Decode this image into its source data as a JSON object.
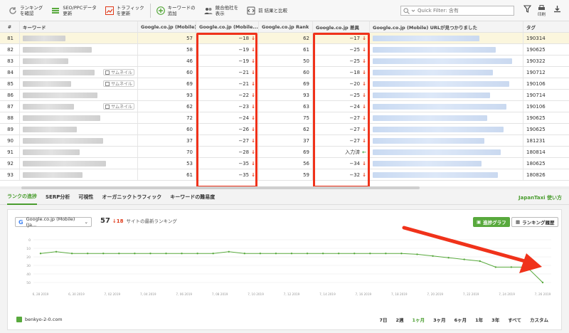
{
  "toolbar": {
    "buttons": [
      {
        "label": "ランキング\nを確認",
        "icon": "refresh-icon"
      },
      {
        "label": "SEO/PPCデータ\n更新",
        "icon": "list-icon"
      },
      {
        "label": "トラフィック\nを更新",
        "icon": "chart-up-icon"
      },
      {
        "label": "キーワードの\n追加",
        "icon": "plus-circle-icon"
      },
      {
        "label": "競合他社を\n表示",
        "icon": "users-icon"
      },
      {
        "label": "前 結果と比較",
        "icon": "compare-icon"
      }
    ],
    "quick_filter_placeholder": "Quick Filter: 含有",
    "right_label": "印刷"
  },
  "columns": [
    "#",
    "キーワード",
    "Google.co.jp (Mobile) ...",
    "Google.co.jp (Mobile...",
    "Google.co.jp Rank",
    "Google.co.jp 差異",
    "Google.co.jp (Mobile) URLが見つかりました",
    "タグ"
  ],
  "thumb_label": "サムネイル",
  "rows": [
    {
      "n": "81",
      "m": "57",
      "md": "−18",
      "r": "62",
      "rd": "−17",
      "tag": "190314",
      "thumb": false,
      "rd_dir": "down",
      "sel": true
    },
    {
      "n": "82",
      "m": "58",
      "md": "−19",
      "r": "61",
      "rd": "−25",
      "tag": "190625",
      "thumb": false,
      "rd_dir": "down"
    },
    {
      "n": "83",
      "m": "46",
      "md": "−19",
      "r": "50",
      "rd": "−25",
      "tag": "190322",
      "thumb": false,
      "rd_dir": "down"
    },
    {
      "n": "84",
      "m": "60",
      "md": "−21",
      "r": "60",
      "rd": "−18",
      "tag": "190712",
      "thumb": true,
      "rd_dir": "down"
    },
    {
      "n": "85",
      "m": "69",
      "md": "−21",
      "r": "69",
      "rd": "−20",
      "tag": "190106",
      "thumb": true,
      "rd_dir": "down"
    },
    {
      "n": "86",
      "m": "93",
      "md": "−22",
      "r": "93",
      "rd": "−25",
      "tag": "190714",
      "thumb": false,
      "rd_dir": "down"
    },
    {
      "n": "87",
      "m": "62",
      "md": "−23",
      "r": "63",
      "rd": "−24",
      "tag": "190106",
      "thumb": true,
      "rd_dir": "down"
    },
    {
      "n": "88",
      "m": "72",
      "md": "−24",
      "r": "75",
      "rd": "−27",
      "tag": "190625",
      "thumb": false,
      "rd_dir": "down"
    },
    {
      "n": "89",
      "m": "60",
      "md": "−26",
      "r": "62",
      "rd": "−27",
      "tag": "190625",
      "thumb": false,
      "rd_dir": "down"
    },
    {
      "n": "90",
      "m": "37",
      "md": "−27",
      "r": "37",
      "rd": "−27",
      "tag": "181231",
      "thumb": false,
      "rd_dir": "down"
    },
    {
      "n": "91",
      "m": "70",
      "md": "−28",
      "r": "69",
      "rd": "入力済",
      "tag": "180814",
      "thumb": false,
      "rd_dir": "left"
    },
    {
      "n": "92",
      "m": "53",
      "md": "−35",
      "r": "56",
      "rd": "−34",
      "tag": "180625",
      "thumb": false,
      "rd_dir": "down"
    },
    {
      "n": "93",
      "m": "61",
      "md": "−35",
      "r": "59",
      "rd": "−32",
      "tag": "180826",
      "thumb": false,
      "rd_dir": "down"
    }
  ],
  "tabs": [
    "ランクの進捗",
    "SERP分析",
    "可視性",
    "オーガニックトラフィック",
    "キーワードの難易度"
  ],
  "tab_right": "JapanTaxi 使い方",
  "engine_select": "Google.co.jp (Mobile) (Ja...",
  "rank": {
    "value": "57",
    "change": "18",
    "text": "サイトの最新ランキング"
  },
  "view_buttons": [
    "進捗グラフ",
    "ランキング履歴"
  ],
  "legend_label": "benkyo-2-0.com",
  "ranges": [
    "7日",
    "2週",
    "1ヶ月",
    "3ヶ月",
    "6ヶ月",
    "1年",
    "3年",
    "すべて",
    "カスタム"
  ],
  "colors": {
    "accent": "#58a93d",
    "down": "#e03a1a",
    "highlight": "#f0321a"
  },
  "chart_data": {
    "type": "line",
    "y_ticks": [
      "0",
      "10",
      "20",
      "30",
      "40",
      "50"
    ],
    "x_ticks": [
      "6, 28 2019",
      "6, 30 2019",
      "7, 02 2019",
      "7, 04 2019",
      "7, 06 2019",
      "7, 08 2019",
      "7, 10 2019",
      "7, 12 2019",
      "7, 14 2019",
      "7, 16 2019",
      "7, 18 2019",
      "7, 20 2019",
      "7, 22 2019",
      "7, 24 2019",
      "7, 26 2019"
    ],
    "ylim": [
      0,
      55
    ],
    "y_inverted": true,
    "series": [
      {
        "name": "benkyo-2-0.com",
        "values": [
          16,
          14,
          16,
          16,
          16,
          16,
          16,
          16,
          16,
          16,
          16,
          16,
          14,
          16,
          16,
          16,
          16,
          16,
          16,
          16,
          16,
          16,
          16,
          16,
          17,
          19,
          21,
          23,
          25,
          32,
          32,
          32,
          50
        ]
      }
    ]
  }
}
